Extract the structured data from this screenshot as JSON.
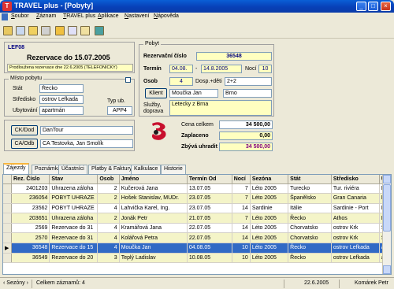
{
  "window": {
    "title": "TRAVEL plus - [Pobyty]",
    "app_icon": "T"
  },
  "titlebar_buttons": {
    "minimize": "_",
    "maximize": "□",
    "close": "×"
  },
  "menu": [
    "Soubor",
    "Záznam",
    "TRAVEL plus",
    "Aplikace",
    "Nastavení",
    "Nápověda"
  ],
  "toolbar_icons": [
    "exit-icon",
    "find-icon",
    "properties-icon",
    "print-icon",
    "open-folder-icon",
    "undo-icon",
    "copy-icon",
    "window-icon"
  ],
  "left": {
    "code": "LEF08",
    "title": "Rezervace do 15.07.2005",
    "note": "Prodloužena rezervace dne 22.6.2005 (TELEFONICKY)",
    "misto_title": "Místo pobytu",
    "stat_label": "Stát",
    "stat_value": "Řecko",
    "stredisko_label": "Středisko",
    "stredisko_value": "ostrov Lefkada",
    "typ_label": "Typ ub.",
    "typ_value": "APP4",
    "ubytovani_label": "Ubytování",
    "ubytovani_value": "apartmán",
    "ck_label": "CK/Dod",
    "ck_value": "DanTour",
    "ca_label": "CA/Odb",
    "ca_value": "CA Testovka, Jan Smolík"
  },
  "right": {
    "pobyt_title": "Pobyt",
    "rez_label": "Rezervační číslo",
    "rez_value": "36548",
    "termin_label": "Termín",
    "termin_from": "04.08.",
    "termin_sep": "-",
    "termin_to": "14.8.2005",
    "noci_label": "Nocí",
    "noci_value": "10",
    "osob_label": "Osob",
    "osob_value": "4",
    "dosp_label": "Dosp.+děti",
    "dosp_value": "2+2",
    "klient_button": "Klient",
    "klient_value": "Moučka Jan",
    "klient_city": "Brno",
    "sluzby_label": "Služby, doprava",
    "sluzby_value": "Letecky z Brna",
    "cena_label": "Cena celkem",
    "cena_value": "34 500,00",
    "zaplaceno_label": "Zaplaceno",
    "zaplaceno_value": "0,00",
    "zbyva_label": "Zbývá uhradit",
    "zbyva_value": "34 500,00"
  },
  "tabs": [
    "Zájezdy",
    "Poznámka",
    "Účastníci",
    "Platby & Faktury",
    "Kalkulace",
    "Historie"
  ],
  "grid": {
    "columns": [
      "Rez. Číslo",
      "Stav",
      "Osob",
      "Jméno",
      "Termín Od",
      "Nocí",
      "Sezóna",
      "Stát",
      "Středisko",
      "Ubyto"
    ],
    "rows": [
      [
        "2401203",
        "Uhrazena záloha",
        "2",
        "Kučerová Jana",
        "13.07.05",
        "7",
        "Léto 2005",
        "Turecko",
        "Tur. riviéra",
        "Homas"
      ],
      [
        "236054",
        "POBYT UHRAZE",
        "2",
        "Hošek Stanislav, MUDr.",
        "23.07.05",
        "7",
        "Léto 2005",
        "Španělsko",
        "Gran Canaria",
        "Hotel E"
      ],
      [
        "23562",
        "POBYT UHRAZE",
        "4",
        "Lahvička Karel, Ing.",
        "23.07.05",
        "14",
        "Sardinie",
        "Itálie",
        "Sardinie - Port",
        "Resider"
      ],
      [
        "203651",
        "Uhrazena záloha",
        "2",
        "Jonák  Petr",
        "21.07.05",
        "7",
        "Léto 2005",
        "Řecko",
        "Athos",
        "Hotel S"
      ],
      [
        "2569",
        "Rezervace do 31",
        "4",
        "Kramářová Jana",
        "22.07.05",
        "14",
        "Léto 2005",
        "Chorvatsko",
        "ostrov Krk",
        "Stan"
      ],
      [
        "2570",
        "Rezervace do 31",
        "4",
        "Kolářová Petra",
        "22.07.05",
        "14",
        "Léto 2005",
        "Chorvatsko",
        "ostrov Krk",
        "Stan"
      ],
      [
        "36548",
        "Rezervace do 15",
        "4",
        "Moučka Jan",
        "04.08.05",
        "10",
        "Léto 2005",
        "Řecko",
        "ostrov Lefkada",
        "apartm"
      ],
      [
        "36549",
        "Rezervace do 20",
        "3",
        "Teplý Ladislav",
        "10.08.05",
        "10",
        "Léto 2005",
        "Řecko",
        "ostrov Lefkada",
        "apartm"
      ]
    ],
    "selected_row": 6,
    "row_indicator": "▶"
  },
  "status": {
    "left": "‹ Sezóny ›",
    "count": "Celkem záznamů: 4",
    "date": "22.6.2005",
    "user": "Komárek Petr"
  },
  "colors": {
    "accent_title": "#000080",
    "zbyva": "#800080",
    "selected_row": "#316ac5",
    "yellow_field": "#ffffc0"
  }
}
